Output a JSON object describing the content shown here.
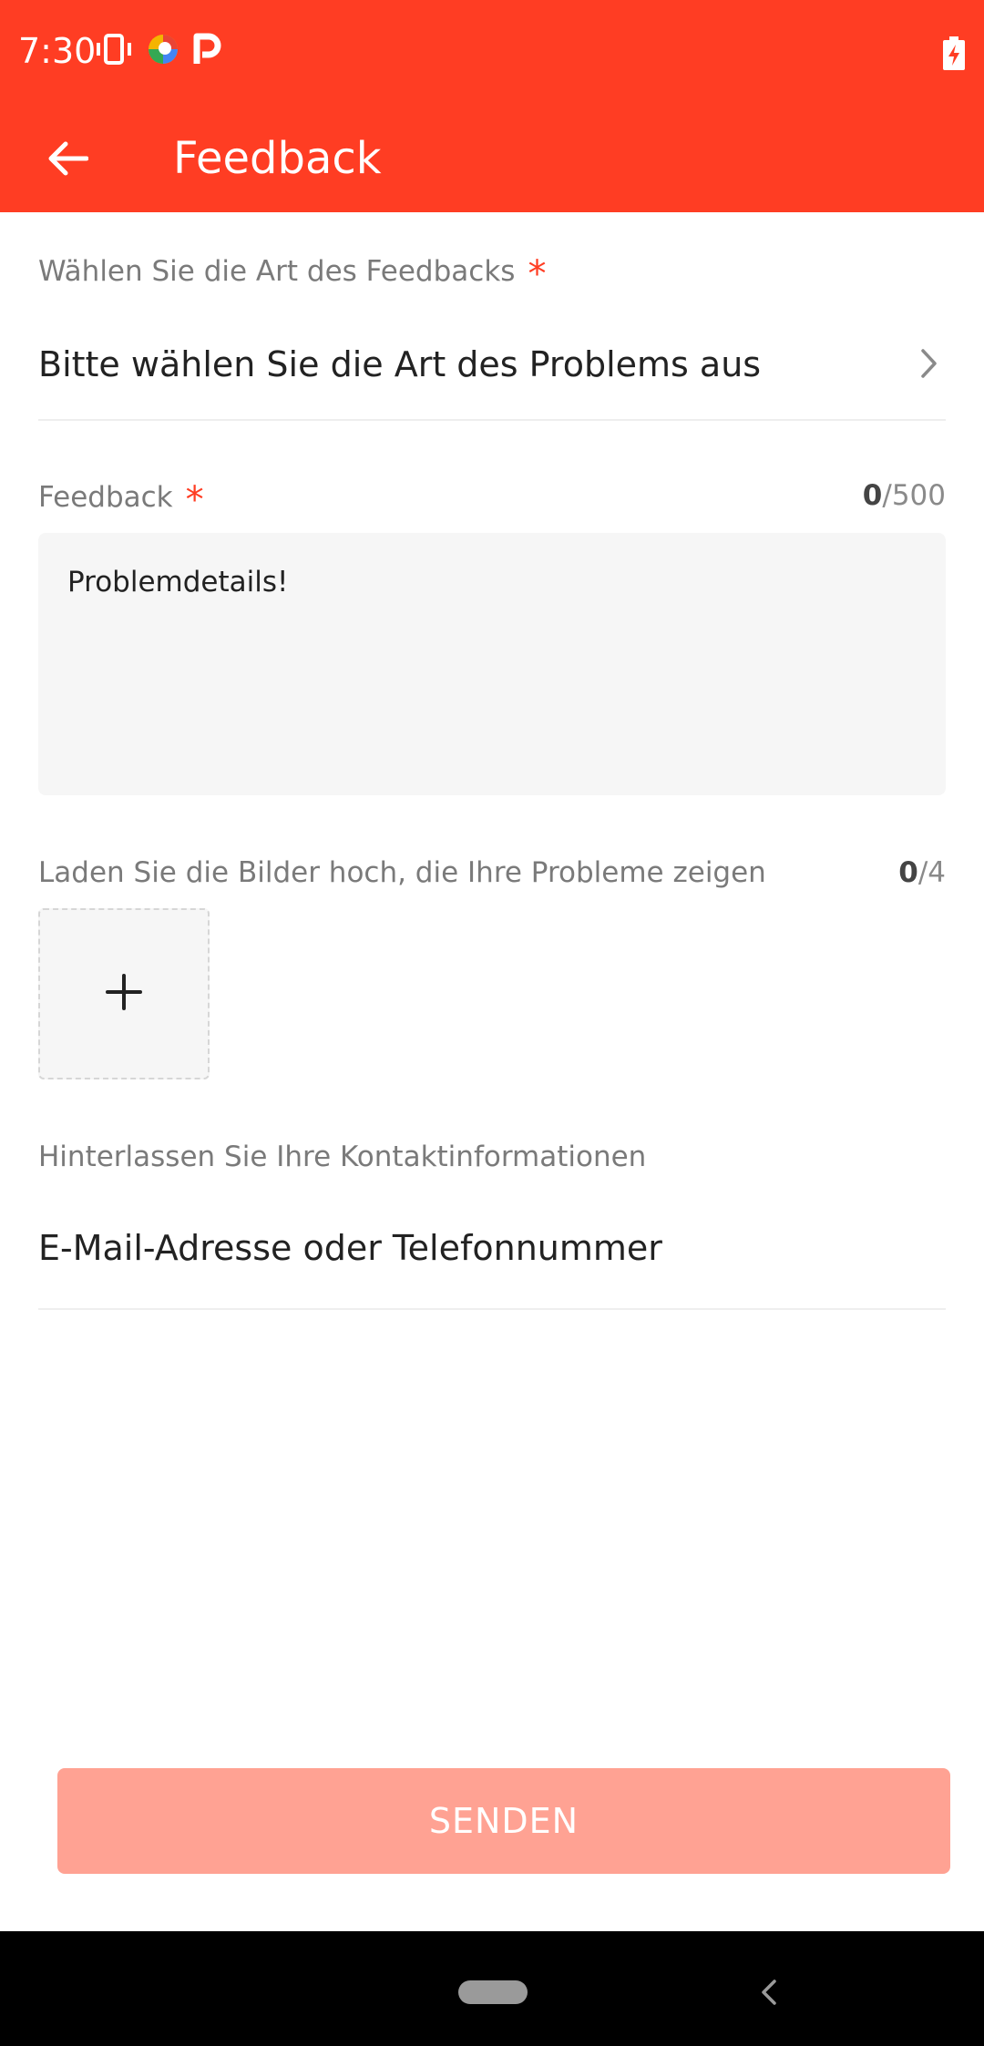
{
  "status_bar": {
    "time": "7:30"
  },
  "header": {
    "title": "Feedback"
  },
  "feedback_type": {
    "label": "Wählen Sie die Art des Feedbacks",
    "required_mark": "*",
    "select_text": "Bitte wählen Sie die Art des Problems aus"
  },
  "feedback": {
    "label": "Feedback",
    "required_mark": "*",
    "counter_current": "0",
    "counter_max": "/500",
    "placeholder": "Problemdetails!"
  },
  "images": {
    "label": "Laden Sie die Bilder hoch, die Ihre Probleme zeigen",
    "counter_current": "0",
    "counter_max": "/4"
  },
  "contact": {
    "label": "Hinterlassen Sie Ihre Kontaktinformationen",
    "placeholder": "E-Mail-Adresse oder Telefonnummer"
  },
  "submit": {
    "label": "SENDEN"
  },
  "colors": {
    "accent": "#ff3d23",
    "button_disabled": "#ffa293"
  }
}
